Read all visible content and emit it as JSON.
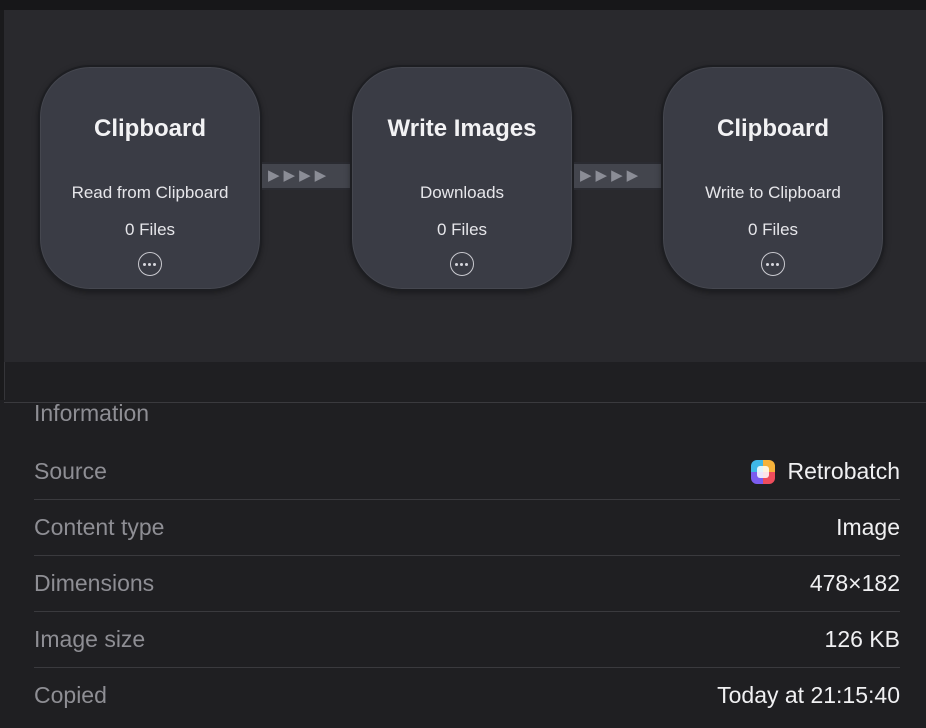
{
  "workflow": {
    "nodes": [
      {
        "title": "Clipboard",
        "subtitle": "Read from Clipboard",
        "files": "0 Files"
      },
      {
        "title": "Write Images",
        "subtitle": "Downloads",
        "files": "0 Files"
      },
      {
        "title": "Clipboard",
        "subtitle": "Write to Clipboard",
        "files": "0 Files"
      }
    ],
    "connector_glyphs": "▶▶▶▶"
  },
  "info": {
    "title": "Information",
    "rows": [
      {
        "label": "Source",
        "value": "Retrobatch",
        "icon": "retrobatch-app-icon"
      },
      {
        "label": "Content type",
        "value": "Image"
      },
      {
        "label": "Dimensions",
        "value": "478×182"
      },
      {
        "label": "Image size",
        "value": "126 KB"
      },
      {
        "label": "Copied",
        "value": "Today at 21:15:40"
      }
    ]
  }
}
